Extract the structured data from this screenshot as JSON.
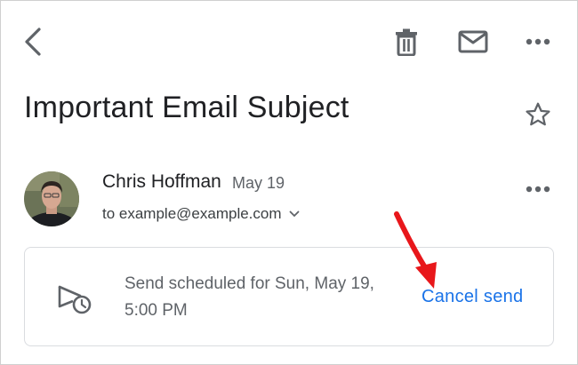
{
  "toolbar": {
    "back_icon": "back-arrow-icon",
    "delete_icon": "trash-icon",
    "mark_unread_icon": "mail-icon",
    "more_icon": "more-horizontal-icon"
  },
  "email": {
    "subject": "Important Email Subject",
    "starred": false,
    "star_icon": "star-outline-icon"
  },
  "message": {
    "sender_name": "Chris Hoffman",
    "date": "May 19",
    "recipient": "to example@example.com",
    "recipient_toggle_icon": "chevron-down-icon",
    "more_icon": "more-horizontal-icon"
  },
  "scheduled": {
    "icon": "scheduled-send-icon",
    "text": "Send scheduled for Sun, May 19, 5:00 PM",
    "action_label": "Cancel send"
  },
  "annotation": {
    "arrow_color": "#e8171b"
  },
  "colors": {
    "link": "#1a73e8",
    "secondary_text": "#5f6368",
    "card_border": "#dadce0"
  }
}
